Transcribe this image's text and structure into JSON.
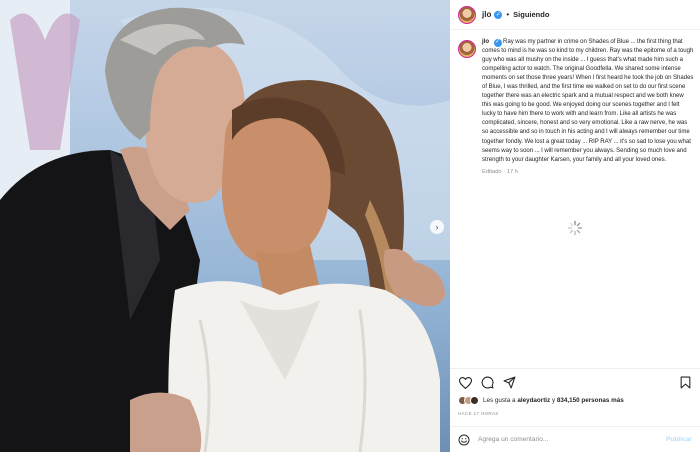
{
  "post": {
    "image_alt": "Photo",
    "next_arrow": "›"
  },
  "header": {
    "username": "jlo",
    "separator": "•",
    "follow_label": "Siguiendo"
  },
  "caption": {
    "username": "jlo",
    "text": "Ray was my partner in crime on Shades of Blue ... the first thing that comes to mind is he was so kind to my children. Ray was the epitome of a tough guy who was all mushy on the inside ... I guess that's what made him such a compelling actor to watch. The original Goodfella. We shared some intense moments on set those three years! When I first heard he took the job on Shades of Blue, I was thrilled, and the first time we walked on set to do our first scene together there was an electric spark and a mutual respect and we both knew this was going to be good. We enjoyed doing our scenes together and I felt lucky to have him there to work with and learn from. Like all artists he was complicated, sincere, honest and so very emotional. Like a raw nerve, he was so accessible and so in touch in his acting and I will always remember our time together fondly. We lost a great today ... RIP RAY ... it's so sad to lose you what seems way to soon ... I will remember you always. Sending so much love and strength to your daughter Karsen, your family and all your loved ones.",
    "edited": "Editado · 17 h"
  },
  "engagement": {
    "likes_prefix": "Les gusta a",
    "liker": "aleydaortiz",
    "likes_join": "y",
    "likes_count": "834,150 personas más",
    "timestamp": "HACE 17 HORAS"
  },
  "comment_box": {
    "placeholder": "Agrega un comentario...",
    "publish_label": "Publicar"
  },
  "icons": [
    "verified-icon",
    "heart-icon",
    "comment-icon",
    "share-icon",
    "bookmark-icon",
    "emoji-icon",
    "loading-spinner-icon"
  ],
  "colors": {
    "verified": "#3897f0",
    "publish_disabled": "#b2dffc",
    "muted": "#8e8e8e"
  }
}
